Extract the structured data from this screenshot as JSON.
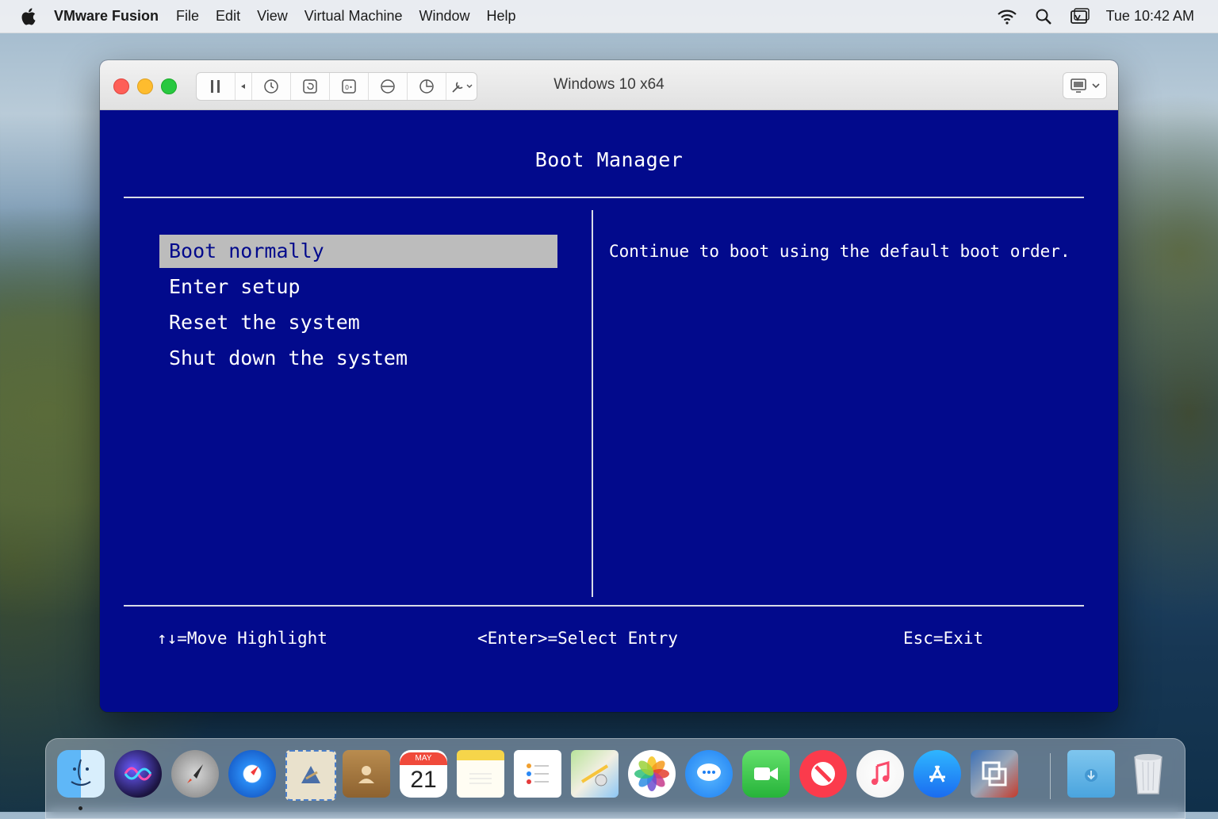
{
  "menubar": {
    "app_name": "VMware Fusion",
    "menus": [
      "File",
      "Edit",
      "View",
      "Virtual Machine",
      "Window",
      "Help"
    ],
    "clock": "Tue 10:42 AM"
  },
  "window": {
    "title": "Windows 10 x64"
  },
  "bios": {
    "title": "Boot Manager",
    "entries": [
      "Boot normally",
      "Enter setup",
      "Reset the system",
      "Shut down the system"
    ],
    "selected_index": 0,
    "description": "Continue to boot using the default boot order.",
    "footer": {
      "move": "↑↓=Move Highlight",
      "select": "<Enter>=Select Entry",
      "exit": "Esc=Exit"
    }
  },
  "calendar_icon": {
    "month": "MAY",
    "day": "21"
  },
  "colors": {
    "bios_background": "#020a8c",
    "bios_text": "#ffffff",
    "selection": "#bcbcbc"
  }
}
